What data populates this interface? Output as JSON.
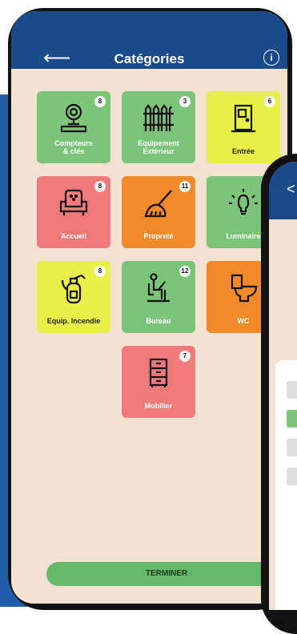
{
  "header": {
    "title": "Catégories"
  },
  "tiles": [
    {
      "label1": "Compteurs",
      "label2": "& clés",
      "count": "8",
      "icon": "meter-icon"
    },
    {
      "label1": "Equipement",
      "label2": "Extérieur",
      "count": "3",
      "icon": "fence-icon"
    },
    {
      "label1": "Entrée",
      "label2": "",
      "count": "6",
      "icon": "door-icon"
    },
    {
      "label1": "Accueil",
      "label2": "",
      "count": "8",
      "icon": "armchair-icon"
    },
    {
      "label1": "Propreté",
      "label2": "",
      "count": "11",
      "icon": "mop-icon"
    },
    {
      "label1": "Luminaire",
      "label2": "",
      "count": "",
      "icon": "lightbulb-icon"
    },
    {
      "label1": "Equip. Incendie",
      "label2": "",
      "count": "8",
      "icon": "extinguisher-icon"
    },
    {
      "label1": "Bureau",
      "label2": "",
      "count": "12",
      "icon": "desk-person-icon"
    },
    {
      "label1": "WC",
      "label2": "",
      "count": "",
      "icon": "toilet-icon"
    },
    {
      "label1": "Mobilier",
      "label2": "",
      "count": "7",
      "icon": "cabinet-icon"
    }
  ],
  "footer": {
    "button_label": "TERMINER"
  },
  "colors": {
    "header": "#1a4a8a",
    "background": "#f2e2cf",
    "green": "#7cc47a",
    "yellow": "#e8f04a",
    "red": "#f07a7a",
    "orange": "#f08a2a"
  }
}
